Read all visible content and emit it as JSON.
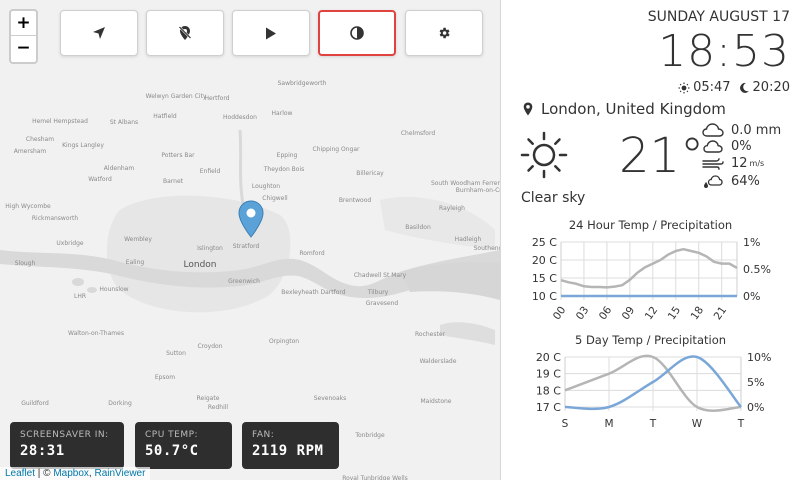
{
  "toolbar": {
    "buttons": [
      {
        "name": "navigate-button",
        "icon": "navigation-arrow-icon",
        "active": false
      },
      {
        "name": "location-off-button",
        "icon": "location-off-icon",
        "active": false
      },
      {
        "name": "play-button",
        "icon": "play-icon",
        "active": false
      },
      {
        "name": "contrast-button",
        "icon": "contrast-icon",
        "active": true
      },
      {
        "name": "settings-button",
        "icon": "gear-icon",
        "active": false
      }
    ],
    "active_color": "#e0433f"
  },
  "zoom": {
    "in_label": "+",
    "out_label": "−"
  },
  "map": {
    "places": [
      {
        "name": "London",
        "size": "big"
      },
      {
        "name": "Stratford",
        "size": "small"
      },
      {
        "name": "Islington",
        "size": "small"
      },
      {
        "name": "Greenwich",
        "size": "small"
      },
      {
        "name": "Romford",
        "size": "small"
      },
      {
        "name": "Basildon",
        "size": "small"
      },
      {
        "name": "Chelmsford",
        "size": "small"
      },
      {
        "name": "Harlow",
        "size": "small"
      },
      {
        "name": "Watford",
        "size": "small"
      },
      {
        "name": "St Albans",
        "size": "small"
      },
      {
        "name": "Hatfield",
        "size": "small"
      },
      {
        "name": "Hertford",
        "size": "small"
      },
      {
        "name": "Hoddesdon",
        "size": "small"
      },
      {
        "name": "Epping",
        "size": "small"
      },
      {
        "name": "Loughton",
        "size": "small"
      },
      {
        "name": "Chigwell",
        "size": "small"
      },
      {
        "name": "Brentwood",
        "size": "small"
      },
      {
        "name": "Billericay",
        "size": "small"
      },
      {
        "name": "Enfield",
        "size": "small"
      },
      {
        "name": "Barnet",
        "size": "small"
      },
      {
        "name": "Potters Bar",
        "size": "small"
      },
      {
        "name": "Wembley",
        "size": "small"
      },
      {
        "name": "Uxbridge",
        "size": "small"
      },
      {
        "name": "Ealing",
        "size": "small"
      },
      {
        "name": "Hounslow",
        "size": "small"
      },
      {
        "name": "LHR",
        "size": "small"
      },
      {
        "name": "Slough",
        "size": "small"
      },
      {
        "name": "Walton-on-Thames",
        "size": "small"
      },
      {
        "name": "Sutton",
        "size": "small"
      },
      {
        "name": "Croydon",
        "size": "small"
      },
      {
        "name": "Orpington",
        "size": "small"
      },
      {
        "name": "Bexleyheath",
        "size": "small"
      },
      {
        "name": "Dartford",
        "size": "small"
      },
      {
        "name": "Tilbury",
        "size": "small"
      },
      {
        "name": "Chadwell St Mary",
        "size": "small"
      },
      {
        "name": "Gravesend",
        "size": "small"
      },
      {
        "name": "Rochester",
        "size": "small"
      },
      {
        "name": "Hadleigh",
        "size": "small"
      },
      {
        "name": "Southend",
        "size": "small"
      },
      {
        "name": "Rayleigh",
        "size": "small"
      },
      {
        "name": "Maidstone",
        "size": "small"
      },
      {
        "name": "Sevenoaks",
        "size": "small"
      },
      {
        "name": "Reigate",
        "size": "small"
      },
      {
        "name": "Redhill",
        "size": "small"
      },
      {
        "name": "Guildford",
        "size": "small"
      },
      {
        "name": "Dorking",
        "size": "small"
      },
      {
        "name": "Epsom",
        "size": "small"
      },
      {
        "name": "Tonbridge",
        "size": "small"
      },
      {
        "name": "Royal Tunbridge Wells",
        "size": "small"
      },
      {
        "name": "Crawley",
        "size": "small"
      },
      {
        "name": "Walderslade",
        "size": "small"
      },
      {
        "name": "Amersham",
        "size": "small"
      },
      {
        "name": "High Wycombe",
        "size": "small"
      },
      {
        "name": "Chesham",
        "size": "small"
      },
      {
        "name": "Hemel Hempstead",
        "size": "small"
      },
      {
        "name": "Welwyn Garden City",
        "size": "small"
      },
      {
        "name": "Kings Langley",
        "size": "small"
      },
      {
        "name": "Rickmansworth",
        "size": "small"
      },
      {
        "name": "Aldenham",
        "size": "small"
      },
      {
        "name": "Sawbridgeworth",
        "size": "small"
      },
      {
        "name": "Chipping Ongar",
        "size": "small"
      },
      {
        "name": "Theydon Bois",
        "size": "small"
      },
      {
        "name": "South Woodham Ferrers",
        "size": "small"
      },
      {
        "name": "Burnham-on-Crouch",
        "size": "small"
      }
    ]
  },
  "stats": [
    {
      "label": "SCREENSAVER IN:",
      "value": "28:31"
    },
    {
      "label": "CPU TEMP:",
      "value": "50.7°C"
    },
    {
      "label": "FAN:",
      "value": "2119 RPM"
    }
  ],
  "attribution": {
    "leaflet": "Leaflet",
    "sep": " | © ",
    "mapbox": "Mapbox",
    "comma": ", ",
    "rainviewer": "RainViewer"
  },
  "clock": {
    "date": "SUNDAY AUGUST 17",
    "time": "18:53",
    "sunrise": "05:47",
    "sunset": "20:20"
  },
  "location": "London, United Kingdom",
  "weather": {
    "icon": "sun-icon",
    "temperature": "21°",
    "condition": "Clear sky",
    "rain": "0.0 mm",
    "cloud": "0%",
    "wind": "12",
    "wind_unit": "m/s",
    "humidity": "64%"
  },
  "chart_titles": {
    "hourly": "24 Hour Temp / Precipitation",
    "daily": "5 Day Temp / Precipitation"
  },
  "chart_data": [
    {
      "type": "line",
      "title": "24 Hour Temp / Precipitation",
      "x": [
        0,
        1,
        2,
        3,
        4,
        5,
        6,
        7,
        8,
        9,
        10,
        11,
        12,
        13,
        14,
        15,
        16,
        17,
        18,
        19,
        20,
        21,
        22,
        23
      ],
      "x_tick_labels": [
        "00",
        "03",
        "06",
        "09",
        "12",
        "15",
        "18",
        "21"
      ],
      "x_tick_values": [
        0,
        3,
        6,
        9,
        12,
        15,
        18,
        21
      ],
      "xlim": [
        0,
        23
      ],
      "y_left_ticks": [
        "25 C",
        "20 C",
        "15 C",
        "10 C"
      ],
      "ylim_left": [
        10,
        25
      ],
      "y_right_ticks": [
        "1%",
        "0.5%",
        "0%"
      ],
      "ylim_right": [
        0,
        1
      ],
      "grid": true,
      "series": [
        {
          "axis": "left",
          "color": "#b5b5b5",
          "values": [
            14.4,
            13.8,
            13.4,
            12.7,
            12.5,
            12.5,
            12.4,
            12.6,
            13.0,
            14.5,
            16.5,
            18.0,
            19.0,
            20.0,
            21.5,
            22.5,
            23.0,
            22.5,
            22.0,
            21.0,
            19.5,
            19.0,
            19.0,
            17.8
          ]
        },
        {
          "axis": "right",
          "color": "#7aa7d8",
          "values": [
            0,
            0,
            0,
            0,
            0,
            0,
            0,
            0,
            0,
            0,
            0,
            0,
            0,
            0,
            0,
            0,
            0,
            0,
            0,
            0,
            0,
            0,
            0,
            0
          ]
        }
      ]
    },
    {
      "type": "line",
      "title": "5 Day Temp / Precipitation",
      "categories": [
        "S",
        "M",
        "T",
        "W",
        "T"
      ],
      "y_left_ticks": [
        "20 C",
        "19 C",
        "18 C",
        "17 C"
      ],
      "ylim_left": [
        17,
        20
      ],
      "y_right_ticks": [
        "10%",
        "5%",
        "0%"
      ],
      "ylim_right": [
        0,
        10
      ],
      "grid": true,
      "series": [
        {
          "axis": "left",
          "color": "#b5b5b5",
          "values": [
            18.0,
            19.0,
            20.0,
            17.0,
            17.0
          ]
        },
        {
          "axis": "right",
          "color": "#7aa7d8",
          "values": [
            0,
            0,
            5.0,
            10.0,
            0
          ]
        }
      ]
    }
  ]
}
